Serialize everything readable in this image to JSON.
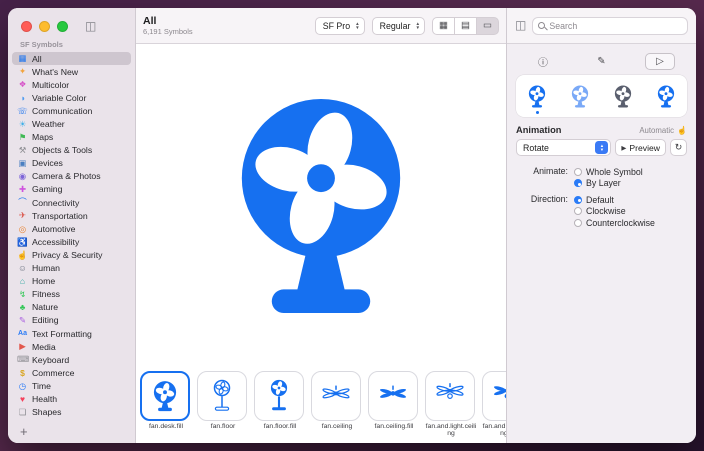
{
  "colors": {
    "accent": "#1670f0",
    "selection_border": "#1670f0"
  },
  "icons": {
    "sidebar_toggle": "◫",
    "panel_toggle": "◫",
    "grid_view": "▦",
    "list_view": "▤",
    "gallery_view": "▭",
    "info_tab": "ⓘ",
    "render_tab": "✎",
    "play_tab": "▷",
    "play_small": "▶",
    "repeat": "↻",
    "hand": "☝",
    "add": "+"
  },
  "sidebar": {
    "header": "SF Symbols",
    "items": [
      {
        "label": "All",
        "icon": "▦",
        "icon_style": "color:#1b73f0",
        "selected": true
      },
      {
        "label": "What's New",
        "icon": "✦",
        "icon_style": "color:#f2a33c"
      },
      {
        "label": "Multicolor",
        "icon": "❖",
        "icon_style": "color:#d653c8"
      },
      {
        "label": "Variable Color",
        "icon": "◑",
        "icon_style": "color:#4f9cf0"
      },
      {
        "label": "Communication",
        "icon": "☏",
        "icon_style": "color:#1b73f0"
      },
      {
        "label": "Weather",
        "icon": "☀",
        "icon_style": "color:#41b0e8"
      },
      {
        "label": "Maps",
        "icon": "⚑",
        "icon_style": "color:#3fb954"
      },
      {
        "label": "Objects & Tools",
        "icon": "⚒",
        "icon_style": "color:#8e8e93"
      },
      {
        "label": "Devices",
        "icon": "▣",
        "icon_style": "color:#4a7fc1"
      },
      {
        "label": "Camera & Photos",
        "icon": "◉",
        "icon_style": "color:#7d64d8"
      },
      {
        "label": "Gaming",
        "icon": "✚",
        "icon_style": "color:#cf52de"
      },
      {
        "label": "Connectivity",
        "icon": "⌒",
        "icon_style": "color:#1b73f0"
      },
      {
        "label": "Transportation",
        "icon": "✈",
        "icon_style": "color:#d94f43"
      },
      {
        "label": "Automotive",
        "icon": "◎",
        "icon_style": "color:#e8883a"
      },
      {
        "label": "Accessibility",
        "icon": "♿",
        "icon_style": "color:#2a7bf6"
      },
      {
        "label": "Privacy & Security",
        "icon": "☝",
        "icon_style": "color:#2a7bf6"
      },
      {
        "label": "Human",
        "icon": "☺",
        "icon_style": "color:#6b7280"
      },
      {
        "label": "Home",
        "icon": "⌂",
        "icon_style": "color:#2aa8a0"
      },
      {
        "label": "Fitness",
        "icon": "↯",
        "icon_style": "color:#35c759"
      },
      {
        "label": "Nature",
        "icon": "♣",
        "icon_style": "color:#35c759"
      },
      {
        "label": "Editing",
        "icon": "✎",
        "icon_style": "color:#a85ce0"
      },
      {
        "label": "Text Formatting",
        "icon": "Aa",
        "icon_style": "color:#2a7bf6;font-size:7px;font-weight:700"
      },
      {
        "label": "Media",
        "icon": "▶",
        "icon_style": "color:#e2574c"
      },
      {
        "label": "Keyboard",
        "icon": "⌨",
        "icon_style": "color:#8e8e93"
      },
      {
        "label": "Commerce",
        "icon": "$",
        "icon_style": "color:#d9a521;font-weight:700"
      },
      {
        "label": "Time",
        "icon": "◷",
        "icon_style": "color:#2a7bf6"
      },
      {
        "label": "Health",
        "icon": "♥",
        "icon_style": "color:#f5415c"
      },
      {
        "label": "Shapes",
        "icon": "❏",
        "icon_style": "color:#8e8e93"
      }
    ],
    "add_button": "+"
  },
  "toolbar": {
    "title": "All",
    "subtitle": "6,191 Symbols",
    "font_select": "SF Pro",
    "weight_select": "Regular"
  },
  "search": {
    "placeholder": "Search"
  },
  "inspector": {
    "variants": [
      {
        "name": "monochrome",
        "style": "color:#1670f0",
        "selected": true
      },
      {
        "name": "hierarchical",
        "style": "color:#7aa9f7"
      },
      {
        "name": "palette",
        "style": "color:#5a5f6e"
      },
      {
        "name": "multicolor",
        "style": "color:#1670f0"
      }
    ],
    "animation": {
      "heading": "Animation",
      "mode": "Automatic",
      "effect": "Rotate",
      "preview": "Preview"
    },
    "animate": {
      "label": "Animate:",
      "options": [
        "Whole Symbol",
        "By Layer"
      ],
      "selected": "By Layer"
    },
    "direction": {
      "label": "Direction:",
      "options": [
        "Default",
        "Clockwise",
        "Counterclockwise"
      ],
      "selected": "Default"
    }
  },
  "gallery": {
    "items": [
      {
        "name": "fan.desk.fill",
        "selected": true
      },
      {
        "name": "fan.floor"
      },
      {
        "name": "fan.floor.fill"
      },
      {
        "name": "fan.ceiling"
      },
      {
        "name": "fan.ceiling.fill"
      },
      {
        "name": "fan.and.light.ceiling"
      },
      {
        "name": "fan.and.light.ceiling.fill"
      }
    ]
  }
}
